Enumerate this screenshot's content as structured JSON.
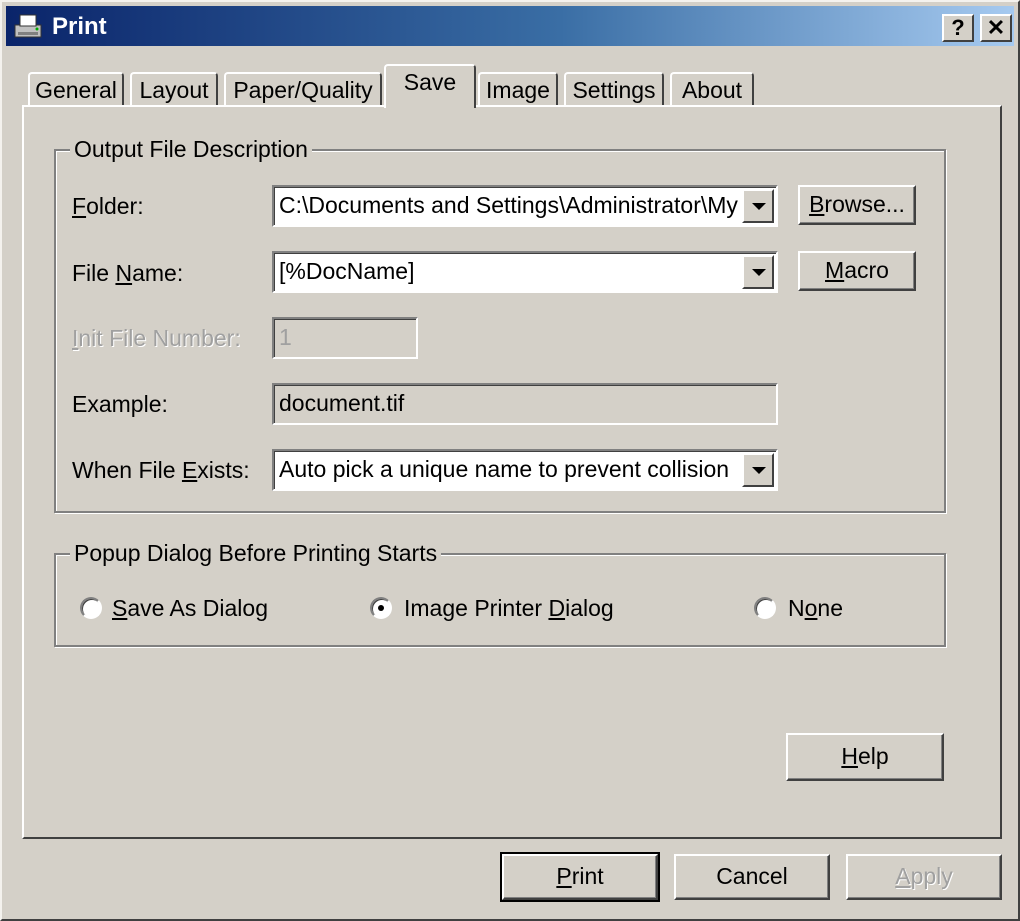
{
  "window": {
    "title": "Print",
    "help_btn": "?",
    "close_btn": "✕"
  },
  "tabs": [
    {
      "label": "General"
    },
    {
      "label": "Layout"
    },
    {
      "label": "Paper/Quality"
    },
    {
      "label": "Save",
      "active": true
    },
    {
      "label": "Image"
    },
    {
      "label": "Settings"
    },
    {
      "label": "About"
    }
  ],
  "output": {
    "legend": "Output File Description",
    "folder": {
      "label_u": "F",
      "label_rest": "older:",
      "value": "C:\\Documents and Settings\\Administrator\\My"
    },
    "filename": {
      "label_a": "File ",
      "label_u": "N",
      "label_b": "ame:",
      "value": "[%DocName]"
    },
    "initnum": {
      "label_u": "I",
      "label_rest": "nit File Number:",
      "value": "1"
    },
    "example": {
      "label": "Example:",
      "value": "document.tif"
    },
    "exists": {
      "label_a": "When File ",
      "label_u": "E",
      "label_b": "xists:",
      "value": "Auto pick a unique name to prevent collision"
    },
    "browse": {
      "label_u": "B",
      "label_rest": "rowse..."
    },
    "macro": {
      "label_u": "M",
      "label_rest": "acro"
    }
  },
  "popup": {
    "legend": "Popup Dialog Before Printing Starts",
    "options": [
      {
        "label_u": "S",
        "label_rest": "ave As Dialog",
        "checked": false
      },
      {
        "label_a": "Image Printer ",
        "label_u": "D",
        "label_b": "ialog",
        "checked": true
      },
      {
        "label_a": "N",
        "label_u": "o",
        "label_b": "ne",
        "checked": false
      }
    ]
  },
  "help_button": {
    "label_u": "H",
    "label_rest": "elp"
  },
  "footer": {
    "print": {
      "label_u": "P",
      "label_rest": "rint"
    },
    "cancel": "Cancel",
    "apply": {
      "label_u": "A",
      "label_rest": "pply"
    }
  }
}
